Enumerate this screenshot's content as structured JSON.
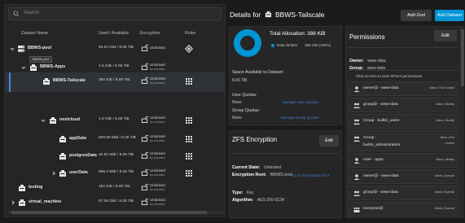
{
  "search": {
    "placeholder": "Search"
  },
  "table": {
    "headers": {
      "name": "Dataset Name",
      "used": "Used / Available",
      "encryption": "Encryption",
      "roles": "Roles"
    },
    "rows": [
      {
        "name": "BBWS-pool",
        "used": "94.53 GiB / 8.06 TiB",
        "enc1": "Unlocked",
        "enc2": "",
        "role": "pool"
      },
      {
        "name": "BBWS-Apps",
        "used": "1.6 GiB / 8.06 TiB",
        "enc1": "Unlocked",
        "enc2": "by ancestor",
        "role": ""
      },
      {
        "name": "BBWS-Tailscale",
        "used": "350 KiB / 8.06 TiB",
        "enc1": "Unlocked",
        "enc2": "by ancestor",
        "role": "apps"
      },
      {
        "name": "nextcloud",
        "used": "1.6 GiB / 8.06 TiB",
        "enc1": "Unlocked",
        "enc2": "by ancestor",
        "role": "apps"
      },
      {
        "name": "appData",
        "used": "609.89 MiB / 8.06 TiB",
        "enc1": "Unlocked",
        "enc2": "by ancestor",
        "role": "apps"
      },
      {
        "name": "postgresData",
        "used": "45.82 MiB / 8.06 TiB",
        "enc1": "Unlocked",
        "enc2": "by ancestor",
        "role": "apps"
      },
      {
        "name": "userData",
        "used": "986.2 MiB / 8.06 TiB",
        "enc1": "Unlocked",
        "enc2": "by ancestor",
        "role": "apps"
      },
      {
        "name": "testing",
        "used": "192 KiB / 8.06 TiB",
        "enc1": "Unlocked",
        "enc2": "by ancestor",
        "role": ""
      },
      {
        "name": "virtual_machine",
        "used": "87.09 GiB / 8.06 TiB",
        "enc1": "Unlocked",
        "enc2": "by ancestor",
        "role": ""
      }
    ],
    "tooltip": "BBWS-pool"
  },
  "details": {
    "title_prefix": "Details for",
    "title_name": "BBWS-Tailscale",
    "add_zvol": "Add Zvol",
    "add_dataset": "Add Dataset"
  },
  "allocation": {
    "title": "Total Allocation: 388 KiB",
    "legend": "Data Written",
    "legend_value": "388 KiB (100%)",
    "fraction_written": 1.0
  },
  "space": {
    "available_label": "Space Available to Dataset:",
    "available_value": "8.06 TiB",
    "user_quotas_label": "User Quotas:",
    "user_quotas_value": "None",
    "user_quotas_link": "Manage User Quotas",
    "group_quotas_label": "Group Quotas:",
    "group_quotas_value": "None",
    "group_quotas_link": "Manage Group Quotas"
  },
  "zfs": {
    "title": "ZFS Encryption",
    "edit": "Edit",
    "state_label": "Current State:",
    "state_value": "Unlocked",
    "root_label": "Encryption Root:",
    "root_value": "/BBWS-pool",
    "go_link": "Go To Encryption Root",
    "type_label": "Type:",
    "type_value": "Key",
    "algo_label": "Algorithm:",
    "algo_value": "AES-256-GCM"
  },
  "permissions": {
    "title": "Permissions",
    "edit": "Edit",
    "owner_label": "Owner:",
    "owner_value": "www-data",
    "group_label": "Group:",
    "group_value": "www-data",
    "hint": "Click an item to view NFSv4 permissions",
    "items": [
      {
        "icon": "user",
        "name": "owner@ - www-data",
        "access": "Allow | Full Control"
      },
      {
        "icon": "group",
        "name": "group@ - www-data",
        "access": "Allow | Modify"
      },
      {
        "icon": "group",
        "name": "Group - builtin_users",
        "access": "Allow | Modify"
      },
      {
        "icon": "group",
        "name": "Group -\nbuiltin_administrators",
        "access": "Allow | Full\nControl"
      },
      {
        "icon": "user",
        "name": "User - apps",
        "access": "Allow | Modify"
      },
      {
        "icon": "user",
        "name": "owner@ - www-data",
        "access": "Allow | Special"
      },
      {
        "icon": "group",
        "name": "group@ - www-data",
        "access": "Allow | Special"
      },
      {
        "icon": "everyone",
        "name": "everyone@",
        "access": "Allow | Special"
      }
    ]
  },
  "colors": {
    "accent": "#0095d5",
    "bg": "#1b1b1b",
    "card": "#262626"
  }
}
